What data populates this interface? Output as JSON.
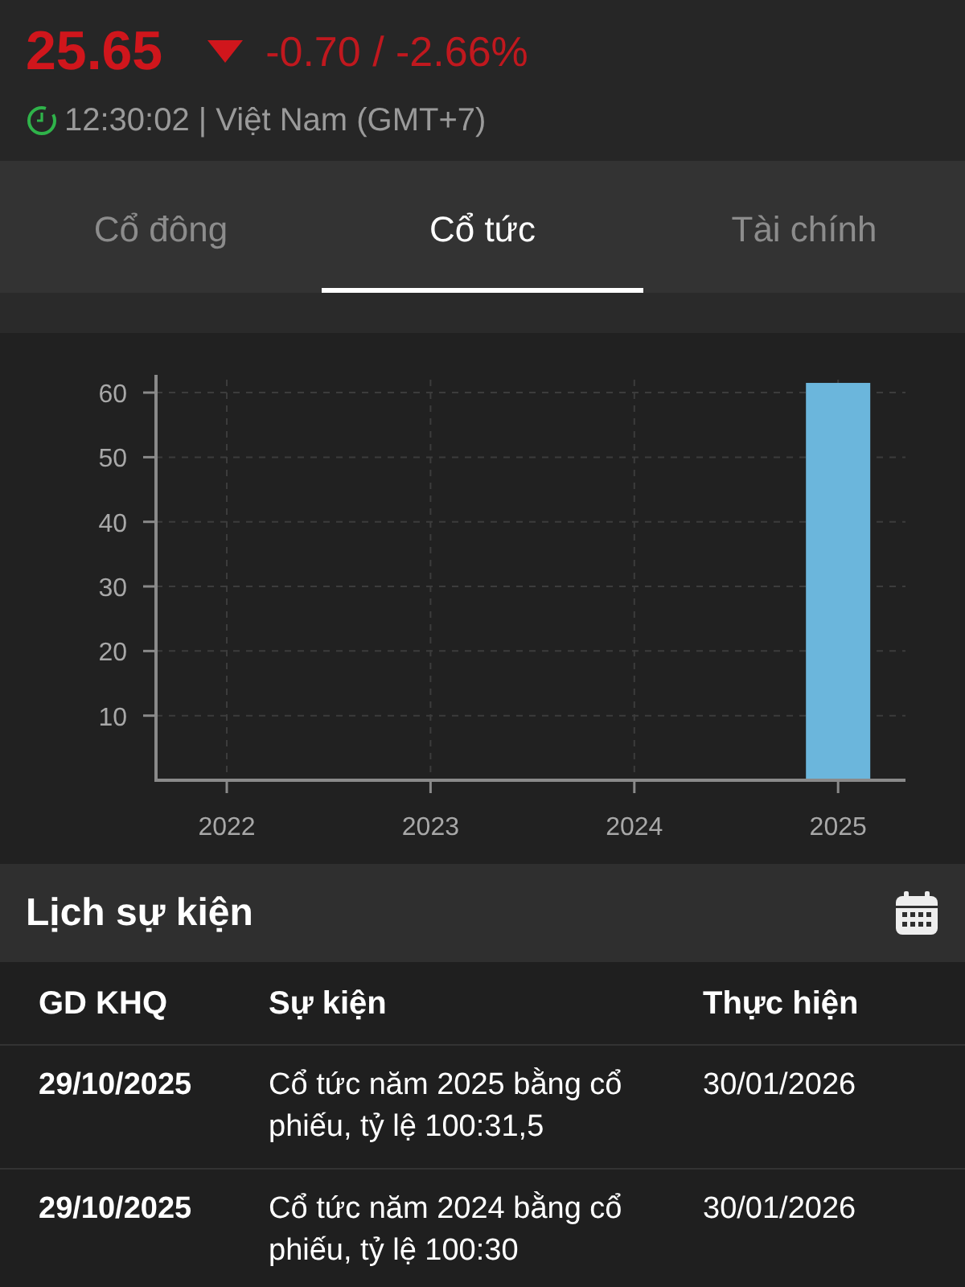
{
  "quote": {
    "price": "25.65",
    "change": "-0.70 / -2.66%",
    "time": "12:30:02 | Việt Nam (GMT+7)"
  },
  "tabs": [
    {
      "label": "Cổ đông",
      "selected": false
    },
    {
      "label": "Cổ tức",
      "selected": true
    },
    {
      "label": "Tài chính",
      "selected": false
    }
  ],
  "chart": {
    "chart_data": {
      "type": "bar",
      "categories": [
        "2022",
        "2023",
        "2024",
        "2025"
      ],
      "series": [
        {
          "color": "#6bb6dc",
          "values": [
            null,
            null,
            null,
            61.5
          ]
        }
      ],
      "ylim": [
        0,
        62
      ],
      "yticks": [
        10,
        20,
        30,
        40,
        50,
        60
      ],
      "grid": true
    }
  },
  "events": {
    "title": "Lịch sự kiện",
    "columns": [
      "GD KHQ",
      "Sự kiện",
      "Thực hiện"
    ],
    "rows": [
      {
        "ex_date": "29/10/2025",
        "event": "Cổ tức năm 2025 bằng cổ phiếu, tỷ lệ 100:31,5",
        "done_date": "30/01/2026"
      },
      {
        "ex_date": "29/10/2025",
        "event": "Cổ tức năm 2024 bằng cổ phiếu, tỷ lệ 100:30",
        "done_date": "30/01/2026"
      }
    ]
  }
}
